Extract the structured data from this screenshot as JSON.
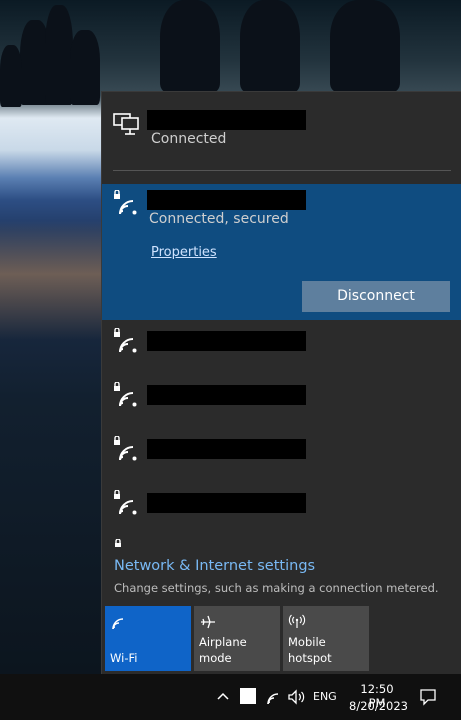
{
  "flyout": {
    "ethernet": {
      "status": "Connected",
      "icon": "ethernet-icon"
    },
    "active_wifi": {
      "status": "Connected, secured",
      "properties_label": "Properties",
      "disconnect_label": "Disconnect",
      "icon": "wifi-secured-icon"
    },
    "other_networks": [
      {
        "icon": "wifi-secured-icon"
      },
      {
        "icon": "wifi-secured-icon"
      },
      {
        "icon": "wifi-secured-icon"
      },
      {
        "icon": "wifi-secured-icon"
      }
    ],
    "settings": {
      "title": "Network & Internet settings",
      "subtitle": "Change settings, such as making a connection metered."
    },
    "quick_actions": [
      {
        "label": "Wi-Fi",
        "icon": "wifi-icon",
        "active": true
      },
      {
        "label": "Airplane mode",
        "icon": "airplane-icon",
        "active": false
      },
      {
        "label_line1": "Mobile",
        "label_line2": "hotspot",
        "icon": "hotspot-icon",
        "active": false
      }
    ]
  },
  "taskbar": {
    "language": "ENG",
    "time": "12:50 PM",
    "date": "8/20/2023"
  },
  "colors": {
    "active_network_bg": "#0f4c80",
    "wifi_tile_bg": "#0f64c8",
    "link_color": "#79b9f4"
  }
}
